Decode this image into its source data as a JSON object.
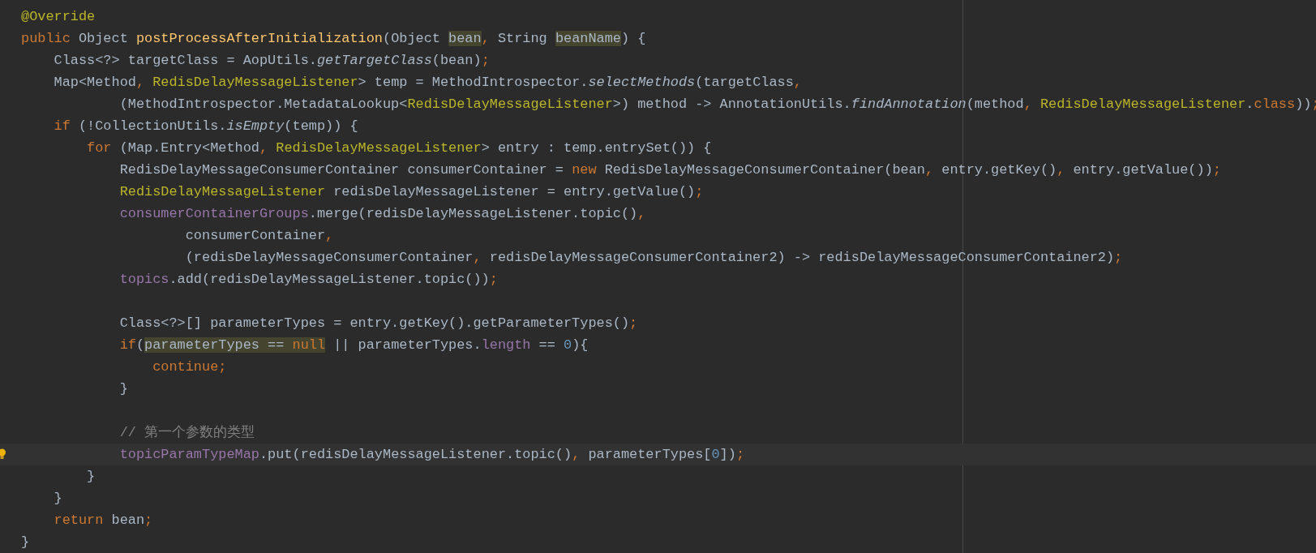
{
  "editor": {
    "lines": [
      {
        "current": false,
        "tokens": [
          {
            "text": "@Override",
            "kind": "annotation"
          }
        ]
      },
      {
        "current": false,
        "tokens": [
          {
            "text": "public ",
            "kind": "keyword"
          },
          {
            "text": "Object ",
            "kind": "plain"
          },
          {
            "text": "postProcessAfterInitialization",
            "kind": "decl"
          },
          {
            "text": "(Object ",
            "kind": "plain"
          },
          {
            "text": "bean",
            "kind": "usage"
          },
          {
            "text": ", ",
            "kind": "punct"
          },
          {
            "text": "String ",
            "kind": "plain"
          },
          {
            "text": "beanName",
            "kind": "usage"
          },
          {
            "text": ") {",
            "kind": "plain"
          }
        ]
      },
      {
        "current": false,
        "tokens": [
          {
            "text": "    Class<?> targetClass = AopUtils.",
            "kind": "plain"
          },
          {
            "text": "getTargetClass",
            "kind": "static"
          },
          {
            "text": "(bean)",
            "kind": "plain"
          },
          {
            "text": ";",
            "kind": "punct"
          }
        ]
      },
      {
        "current": false,
        "tokens": [
          {
            "text": "    Map<Method",
            "kind": "plain"
          },
          {
            "text": ", ",
            "kind": "punct"
          },
          {
            "text": "RedisDelayMessageListener",
            "kind": "type"
          },
          {
            "text": "> temp = MethodIntrospector.",
            "kind": "plain"
          },
          {
            "text": "selectMethods",
            "kind": "static"
          },
          {
            "text": "(targetClass",
            "kind": "plain"
          },
          {
            "text": ",",
            "kind": "punct"
          }
        ]
      },
      {
        "current": false,
        "tokens": [
          {
            "text": "            (MethodIntrospector.MetadataLookup<",
            "kind": "plain"
          },
          {
            "text": "RedisDelayMessageListener",
            "kind": "type"
          },
          {
            "text": ">) method -> AnnotationUtils.",
            "kind": "plain"
          },
          {
            "text": "findAnnotation",
            "kind": "static"
          },
          {
            "text": "(method",
            "kind": "plain"
          },
          {
            "text": ", ",
            "kind": "punct"
          },
          {
            "text": "RedisDelayMessageListener",
            "kind": "type"
          },
          {
            "text": ".",
            "kind": "plain"
          },
          {
            "text": "class",
            "kind": "keyword"
          },
          {
            "text": "))",
            "kind": "plain"
          },
          {
            "text": ";",
            "kind": "punct"
          }
        ]
      },
      {
        "current": false,
        "tokens": [
          {
            "text": "    if ",
            "kind": "keyword"
          },
          {
            "text": "(!CollectionUtils.",
            "kind": "plain"
          },
          {
            "text": "isEmpty",
            "kind": "static"
          },
          {
            "text": "(temp)) {",
            "kind": "plain"
          }
        ]
      },
      {
        "current": false,
        "tokens": [
          {
            "text": "        for ",
            "kind": "keyword"
          },
          {
            "text": "(Map.Entry<Method",
            "kind": "plain"
          },
          {
            "text": ", ",
            "kind": "punct"
          },
          {
            "text": "RedisDelayMessageListener",
            "kind": "type"
          },
          {
            "text": "> entry : temp.entrySet()) {",
            "kind": "plain"
          }
        ]
      },
      {
        "current": false,
        "tokens": [
          {
            "text": "            RedisDelayMessageConsumerContainer consumerContainer = ",
            "kind": "plain"
          },
          {
            "text": "new ",
            "kind": "keyword"
          },
          {
            "text": "RedisDelayMessageConsumerContainer(bean",
            "kind": "plain"
          },
          {
            "text": ", ",
            "kind": "punct"
          },
          {
            "text": "entry.getKey()",
            "kind": "plain"
          },
          {
            "text": ", ",
            "kind": "punct"
          },
          {
            "text": "entry.getValue())",
            "kind": "plain"
          },
          {
            "text": ";",
            "kind": "punct"
          }
        ]
      },
      {
        "current": false,
        "tokens": [
          {
            "text": "            RedisDelayMessageListener",
            "kind": "type"
          },
          {
            "text": " redisDelayMessageListener = entry.getValue()",
            "kind": "plain"
          },
          {
            "text": ";",
            "kind": "punct"
          }
        ]
      },
      {
        "current": false,
        "tokens": [
          {
            "text": "            consumerContainerGroups",
            "kind": "field"
          },
          {
            "text": ".merge(redisDelayMessageListener.topic()",
            "kind": "plain"
          },
          {
            "text": ",",
            "kind": "punct"
          }
        ]
      },
      {
        "current": false,
        "tokens": [
          {
            "text": "                    consumerContainer",
            "kind": "plain"
          },
          {
            "text": ",",
            "kind": "punct"
          }
        ]
      },
      {
        "current": false,
        "tokens": [
          {
            "text": "                    (redisDelayMessageConsumerContainer",
            "kind": "plain"
          },
          {
            "text": ", ",
            "kind": "punct"
          },
          {
            "text": "redisDelayMessageConsumerContainer2) -> redisDelayMessageConsumerContainer2)",
            "kind": "plain"
          },
          {
            "text": ";",
            "kind": "punct"
          }
        ]
      },
      {
        "current": false,
        "tokens": [
          {
            "text": "            topics",
            "kind": "field"
          },
          {
            "text": ".add(redisDelayMessageListener.topic())",
            "kind": "plain"
          },
          {
            "text": ";",
            "kind": "punct"
          }
        ]
      },
      {
        "current": false
      },
      {
        "current": false,
        "tokens": [
          {
            "text": "            Class<?>[] parameterTypes = entry.getKey().getParameterTypes()",
            "kind": "plain"
          },
          {
            "text": ";",
            "kind": "punct"
          }
        ]
      },
      {
        "current": false,
        "tokens": [
          {
            "text": "            if",
            "kind": "keyword"
          },
          {
            "text": "(",
            "kind": "plain"
          },
          {
            "text": "parameterTypes == ",
            "kind": "usage"
          },
          {
            "text": "null",
            "kind": "usage-keyword"
          },
          {
            "text": " || parameterTypes.",
            "kind": "plain"
          },
          {
            "text": "length",
            "kind": "field"
          },
          {
            "text": " == ",
            "kind": "plain"
          },
          {
            "text": "0",
            "kind": "number"
          },
          {
            "text": "){",
            "kind": "plain"
          }
        ]
      },
      {
        "current": false,
        "tokens": [
          {
            "text": "                continue",
            "kind": "keyword"
          },
          {
            "text": ";",
            "kind": "punct"
          }
        ]
      },
      {
        "current": false,
        "tokens": [
          {
            "text": "            }",
            "kind": "plain"
          }
        ]
      },
      {
        "current": false
      },
      {
        "current": false,
        "tokens": [
          {
            "text": "            // 第一个参数的类型",
            "kind": "comment"
          }
        ]
      },
      {
        "current": true,
        "tokens": [
          {
            "text": "            topicParamTypeMap",
            "kind": "field"
          },
          {
            "text": ".put(redisDelayMessageListener.topic()",
            "kind": "plain"
          },
          {
            "text": ", ",
            "kind": "punct"
          },
          {
            "text": "parameterTypes[",
            "kind": "plain"
          },
          {
            "text": "0",
            "kind": "number"
          },
          {
            "text": "])",
            "kind": "plain"
          },
          {
            "text": ";",
            "kind": "punct"
          }
        ]
      },
      {
        "current": false,
        "tokens": [
          {
            "text": "        }",
            "kind": "plain"
          }
        ]
      },
      {
        "current": false,
        "tokens": [
          {
            "text": "    }",
            "kind": "plain"
          }
        ]
      },
      {
        "current": false,
        "tokens": [
          {
            "text": "    return ",
            "kind": "keyword"
          },
          {
            "text": "bean",
            "kind": "plain"
          },
          {
            "text": ";",
            "kind": "punct"
          }
        ]
      },
      {
        "current": false,
        "tokens": [
          {
            "text": "}",
            "kind": "plain"
          }
        ]
      }
    ]
  }
}
